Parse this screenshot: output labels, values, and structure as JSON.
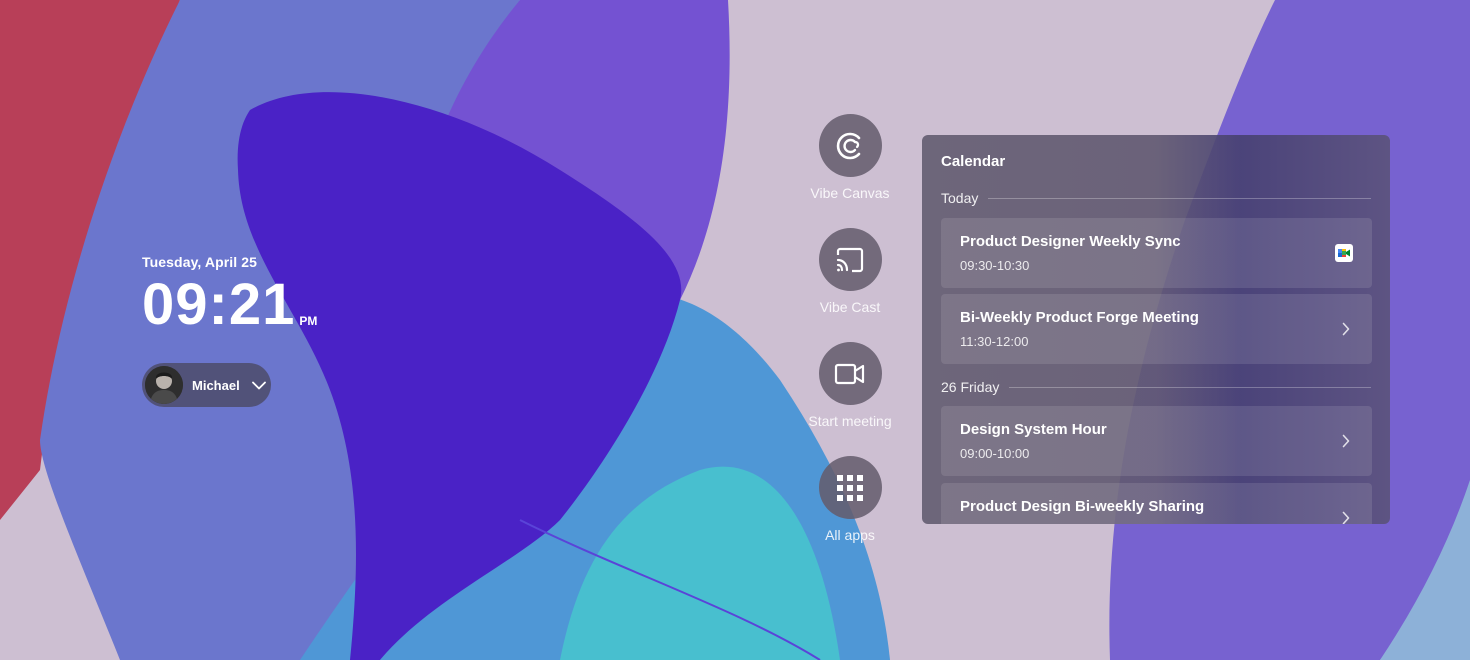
{
  "clock": {
    "date": "Tuesday, April 25",
    "time": "09:21",
    "ampm": "PM"
  },
  "user": {
    "name": "Michael",
    "avatar_icon": "person-avatar"
  },
  "launcher": [
    {
      "label": "Vibe Canvas",
      "icon": "vibe-canvas-icon"
    },
    {
      "label": "Vibe Cast",
      "icon": "cast-icon"
    },
    {
      "label": "Start meeting",
      "icon": "video-camera-icon"
    },
    {
      "label": "All apps",
      "icon": "grid-icon"
    }
  ],
  "calendar": {
    "title": "Calendar",
    "groups": [
      {
        "day": "Today",
        "events": [
          {
            "title": "Product Designer Weekly Sync",
            "time": "09:30-10:30",
            "action_icon": "google-meet-icon"
          },
          {
            "title": "Bi-Weekly Product Forge Meeting",
            "time": "11:30-12:00",
            "action_icon": "chevron-right-icon"
          }
        ]
      },
      {
        "day": "26 Friday",
        "events": [
          {
            "title": "Design System Hour",
            "time": "09:00-10:00",
            "action_icon": "chevron-right-icon"
          },
          {
            "title": "Product Design Bi-weekly Sharing",
            "time": "",
            "action_icon": "chevron-right-icon"
          }
        ]
      }
    ]
  },
  "colors": {
    "wallpaper_base": "#cdbfd2",
    "deep_purple": "#4a22c6",
    "violet": "#7452d2",
    "periwinkle": "#6f74cc",
    "crimson": "#b83f58",
    "sky_blue": "#4f97d6",
    "teal": "#48bfcf"
  }
}
